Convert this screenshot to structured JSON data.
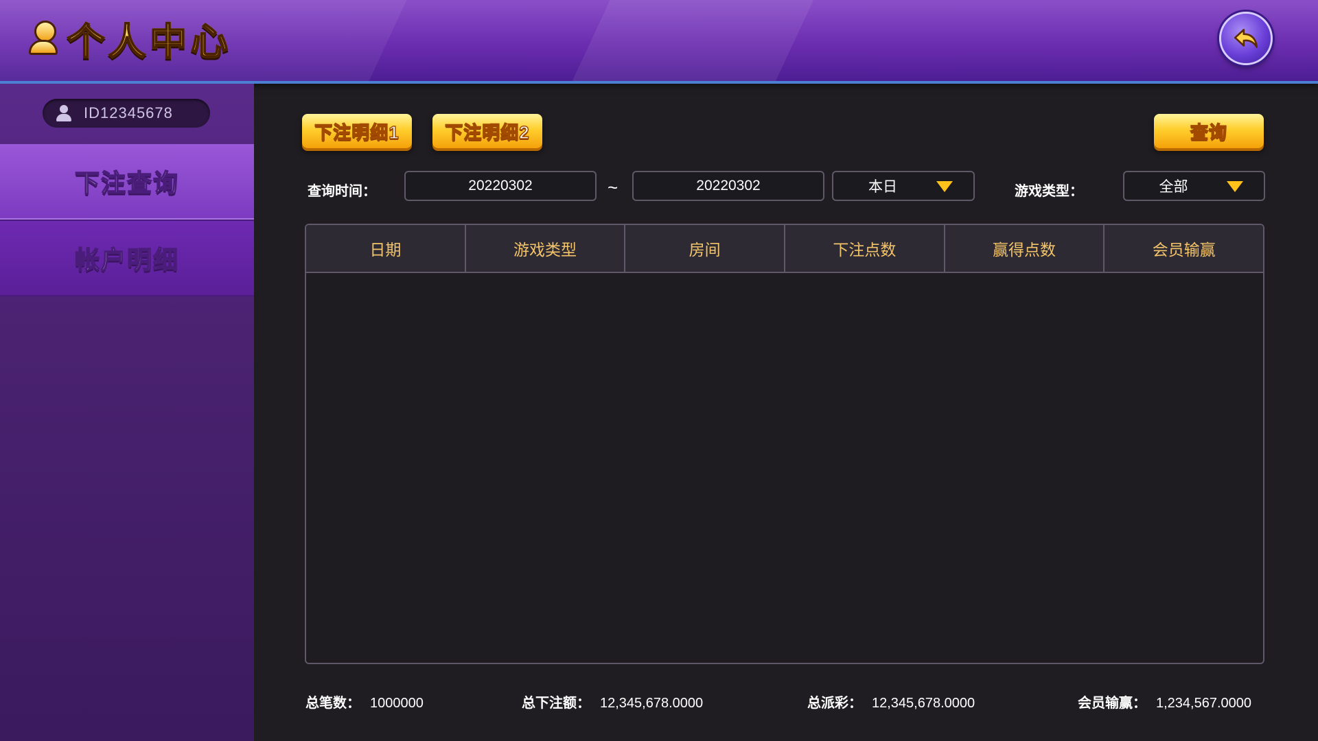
{
  "header": {
    "title": "个人中心"
  },
  "sidebar": {
    "user_id": "ID12345678",
    "items": [
      {
        "label": "下注查询",
        "active": true
      },
      {
        "label": "帐户明细",
        "active": false
      }
    ]
  },
  "toolbar": {
    "tab1_label": "下注明细1",
    "tab2_label": "下注明细2",
    "query_label": "查询"
  },
  "filters": {
    "time_label": "查询时间：",
    "start_date": "20220302",
    "separator": "~",
    "end_date": "20220302",
    "period": "本日",
    "game_type_label": "游戏类型：",
    "game_type": "全部"
  },
  "table": {
    "columns": [
      "日期",
      "游戏类型",
      "房间",
      "下注点数",
      "赢得点数",
      "会员输赢"
    ],
    "rows": []
  },
  "summary": {
    "count_label": "总笔数：",
    "count_value": "1000000",
    "bet_label": "总下注额：",
    "bet_value": "12,345,678.0000",
    "payout_label": "总派彩：",
    "payout_value": "12,345,678.0000",
    "winloss_label": "会员输赢：",
    "winloss_value": "1,234,567.0000"
  },
  "colors": {
    "accent_gold": "#ffc21a",
    "header_purple": "#6b2db0",
    "column_header_text": "#f3c46a"
  }
}
